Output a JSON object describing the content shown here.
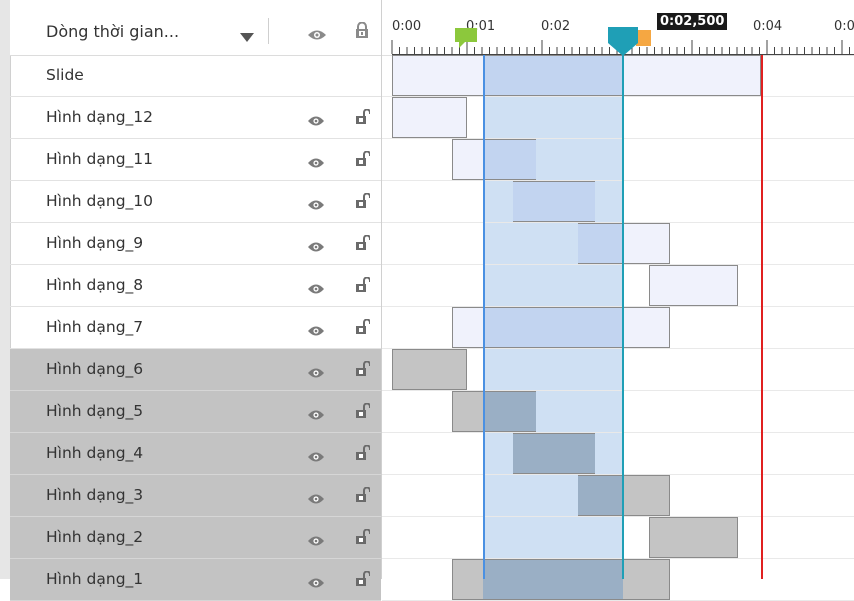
{
  "colors": {
    "selected_row_bg": "#c3c3c3",
    "playhead": "#1f9fb6",
    "start_marker": "#8cc83c",
    "end_marker": "#f5a742",
    "range_line": "#4a90e2",
    "end_line": "#e02020",
    "light_bar": "#f0f2fc",
    "grey_bar": "#c4c4c4",
    "shade": "#cfe0f3"
  },
  "header": {
    "title": "Dòng thời gian...",
    "dropdown_icon": "dropdown-arrow-icon",
    "visibility_icon": "eye-icon",
    "lock_icon": "lock-icon"
  },
  "ruler": {
    "tick_labels": [
      "0:00",
      "0:01",
      "0:02",
      "0:04",
      "0:0"
    ],
    "current_time": "0:02,500"
  },
  "layers": [
    {
      "label": "Slide",
      "selected": false,
      "has_icons": false
    },
    {
      "label": "Hình dạng_12",
      "selected": false,
      "has_icons": true
    },
    {
      "label": "Hình dạng_11",
      "selected": false,
      "has_icons": true
    },
    {
      "label": "Hình dạng_10",
      "selected": false,
      "has_icons": true
    },
    {
      "label": "Hình dạng_9",
      "selected": false,
      "has_icons": true
    },
    {
      "label": "Hình dạng_8",
      "selected": false,
      "has_icons": true
    },
    {
      "label": "Hình dạng_7",
      "selected": false,
      "has_icons": true
    },
    {
      "label": "Hình dạng_6",
      "selected": true,
      "has_icons": true
    },
    {
      "label": "Hình dạng_5",
      "selected": true,
      "has_icons": true
    },
    {
      "label": "Hình dạng_4",
      "selected": true,
      "has_icons": true
    },
    {
      "label": "Hình dạng_3",
      "selected": true,
      "has_icons": true
    },
    {
      "label": "Hình dạng_2",
      "selected": true,
      "has_icons": true
    },
    {
      "label": "Hình dạng_1",
      "selected": true,
      "has_icons": true
    }
  ]
}
